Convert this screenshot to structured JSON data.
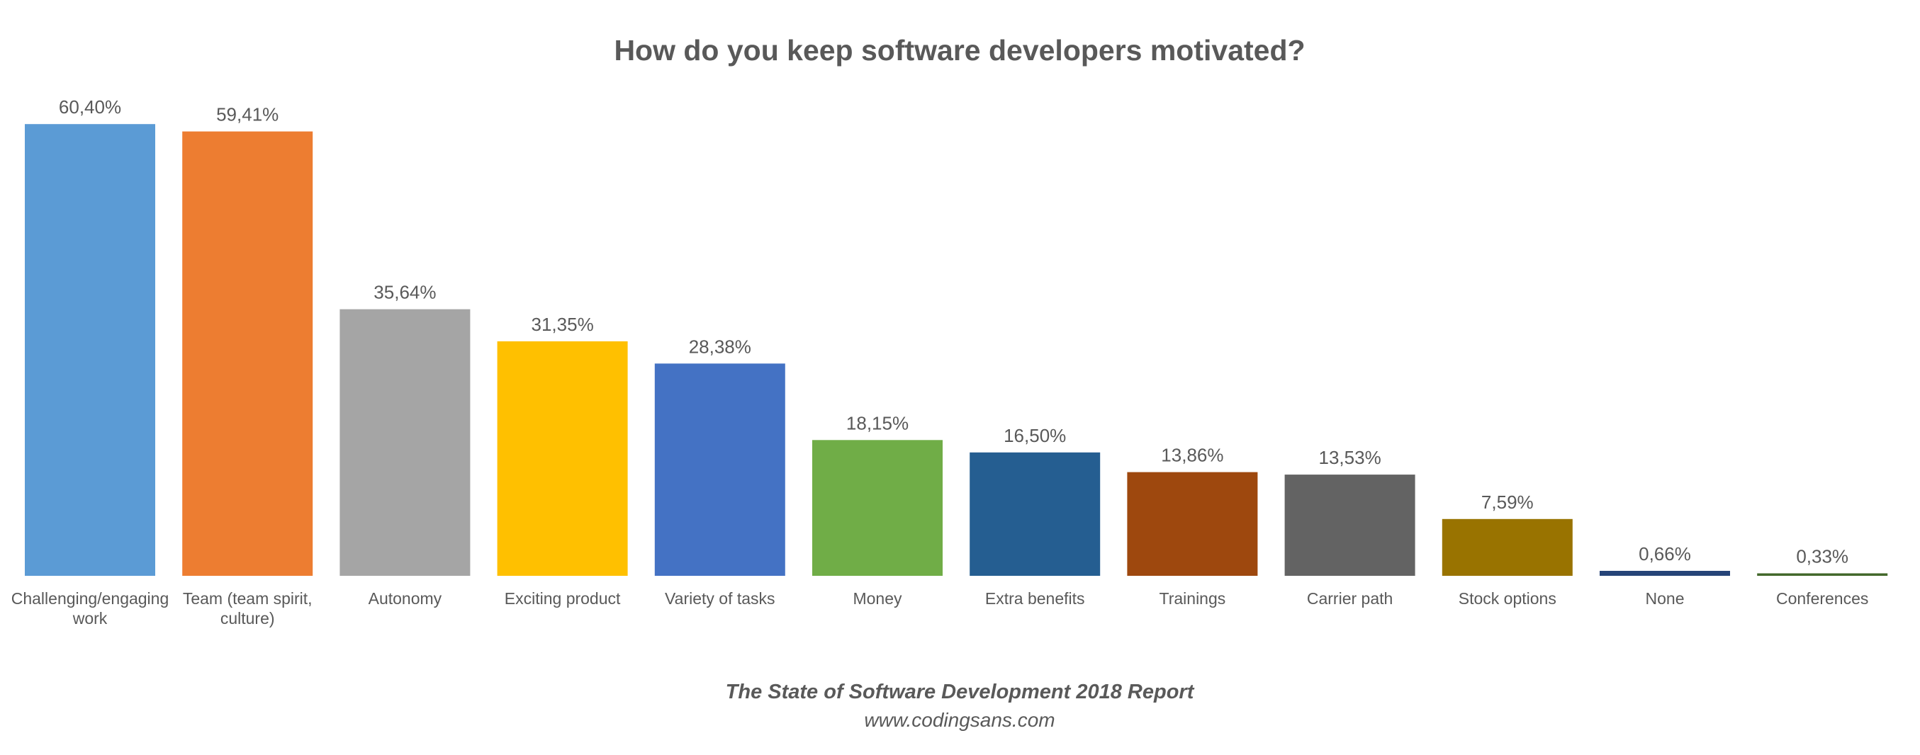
{
  "chart_data": {
    "type": "bar",
    "title": "How do you keep software developers motivated?",
    "xlabel": "",
    "ylabel": "",
    "ylim": [
      0,
      61
    ],
    "grid": false,
    "legend": "none",
    "categories": [
      "Challenging/engaging work",
      "Team (team spirit, culture)",
      "Autonomy",
      "Exciting product",
      "Variety of tasks",
      "Money",
      "Extra benefits",
      "Trainings",
      "Carrier path",
      "Stock options",
      "None",
      "Conferences"
    ],
    "category_label_lines": [
      [
        "Challenging/engaging",
        "work"
      ],
      [
        "Team (team spirit,",
        "culture)"
      ],
      [
        "Autonomy"
      ],
      [
        "Exciting product"
      ],
      [
        "Variety of tasks"
      ],
      [
        "Money"
      ],
      [
        "Extra benefits"
      ],
      [
        "Trainings"
      ],
      [
        "Carrier path"
      ],
      [
        "Stock options"
      ],
      [
        "None"
      ],
      [
        "Conferences"
      ]
    ],
    "values": [
      60.4,
      59.41,
      35.64,
      31.35,
      28.38,
      18.15,
      16.5,
      13.86,
      13.53,
      7.59,
      0.66,
      0.33
    ],
    "data_labels": [
      "60,40%",
      "59,41%",
      "35,64%",
      "31,35%",
      "28,38%",
      "18,15%",
      "16,50%",
      "13,86%",
      "13,53%",
      "7,59%",
      "0,66%",
      "0,33%"
    ],
    "colors": [
      "#5b9bd5",
      "#ed7d31",
      "#a5a5a5",
      "#ffc000",
      "#4472c4",
      "#70ad47",
      "#255e91",
      "#9e480e",
      "#636363",
      "#997300",
      "#264478",
      "#43682b"
    ],
    "unit": "%"
  },
  "footer": {
    "source": "The State of Software Development 2018 Report",
    "url": "www.codingsans.com"
  }
}
